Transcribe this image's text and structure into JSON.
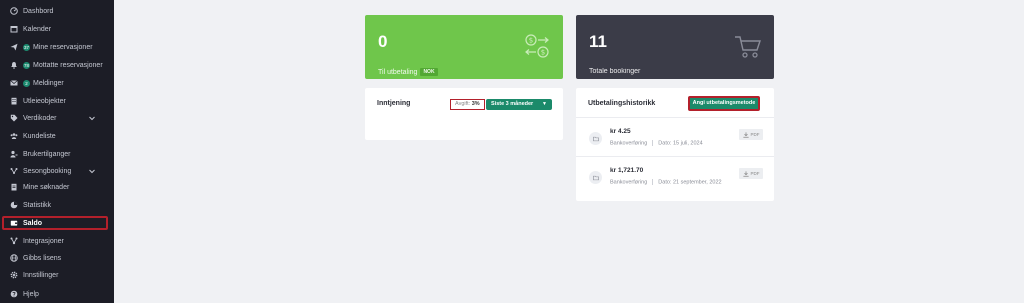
{
  "sidebar": {
    "items": [
      {
        "label": "Dashbord",
        "icon": "dashboard-icon"
      },
      {
        "label": "Kalender",
        "icon": "calendar-icon"
      },
      {
        "label": "Mine reservasjoner",
        "icon": "send-icon",
        "badge": "37"
      },
      {
        "label": "Mottatte reservasjoner",
        "icon": "bell-icon",
        "badge": "78"
      },
      {
        "label": "Meldinger",
        "icon": "mail-icon",
        "badge": "2"
      },
      {
        "label": "Utleieobjekter",
        "icon": "building-icon"
      },
      {
        "label": "Verdikoder",
        "icon": "tag-icon",
        "expandable": true
      },
      {
        "label": "Kundeliste",
        "icon": "users-icon"
      },
      {
        "label": "Brukertilganger",
        "icon": "user-key-icon"
      },
      {
        "label": "Sesongbooking",
        "icon": "network-icon",
        "expandable": true
      },
      {
        "label": "Mine søknader",
        "icon": "document-icon"
      },
      {
        "label": "Statistikk",
        "icon": "pie-chart-icon"
      },
      {
        "label": "Saldo",
        "icon": "wallet-icon",
        "active": true
      },
      {
        "label": "Integrasjoner",
        "icon": "integration-icon"
      },
      {
        "label": "Gibbs lisens",
        "icon": "globe-icon"
      },
      {
        "label": "Innstillinger",
        "icon": "gear-icon"
      },
      {
        "label": "Hjelp",
        "icon": "help-icon"
      }
    ]
  },
  "stats": {
    "payout": {
      "value": "0",
      "label": "Til utbetaling",
      "currency": "NOK",
      "icon": "currency-exchange-icon",
      "color": "#6fc64b"
    },
    "bookings": {
      "value": "11",
      "label": "Totale bookinger",
      "icon": "cart-icon",
      "color": "#3b3c48"
    }
  },
  "earnings": {
    "title": "Inntjening",
    "fee_label": "Avgift:",
    "fee_value": "3%",
    "period_selected": "Siste 3 måneder"
  },
  "payout_history": {
    "title": "Utbetalingshistorikk",
    "set_method_label": "Angi utbetalingsmetode",
    "pdf_label": "PDF",
    "rows": [
      {
        "amount": "kr 4.25",
        "method": "Bankoverføring",
        "date": "Dato: 15 juli, 2024"
      },
      {
        "amount": "kr 1,721.70",
        "method": "Bankoverføring",
        "date": "Dato: 21 september, 2022"
      }
    ]
  },
  "colors": {
    "accent": "#1b8a6a",
    "highlight": "#b3202b",
    "sidebar_bg": "#1c1d26"
  }
}
